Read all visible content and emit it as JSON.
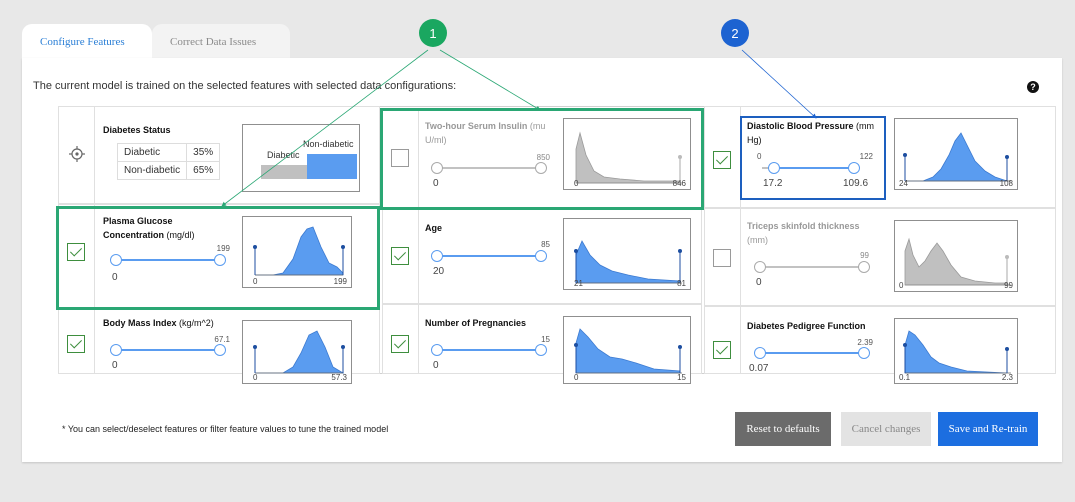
{
  "tabs": [
    {
      "label": "Configure Features",
      "active": true
    },
    {
      "label": "Correct Data Issues",
      "active": false
    }
  ],
  "intro_text": "The current model is trained on the selected features with selected data configurations:",
  "help_icon": "?",
  "target": {
    "title": "Diabetes Status",
    "icon": "crosshair-icon",
    "rows": [
      {
        "label": "Diabetic",
        "pct": "35%"
      },
      {
        "label": "Non-diabetic",
        "pct": "65%"
      }
    ],
    "bar_labels": {
      "left": "Diabetic",
      "right": "Non-diabetic"
    },
    "bar_fractions": {
      "diabetic": 0.35,
      "non_diabetic": 0.65
    }
  },
  "features": {
    "insulin": {
      "title": "Two-hour Serum Insulin",
      "unit": " (mu U/ml)",
      "checked": false,
      "slider_min": "0",
      "slider_max": "850",
      "hist_min": "0",
      "hist_max": "846"
    },
    "bp": {
      "title": "Diastolic Blood Pressure",
      "unit": " (mm Hg)",
      "checked": true,
      "range_min": "0",
      "range_max": "122",
      "slider_min": "17.2",
      "slider_max": "109.6",
      "hist_min": "24",
      "hist_max": "108"
    },
    "glucose": {
      "title": "Plasma Glucose Concentration",
      "unit": " (mg/dl)",
      "checked": true,
      "slider_min": "0",
      "slider_max": "199",
      "hist_min": "0",
      "hist_max": "199"
    },
    "age": {
      "title": "Age",
      "unit": "",
      "checked": true,
      "slider_min": "20",
      "slider_max": "85",
      "hist_min": "21",
      "hist_max": "81"
    },
    "triceps": {
      "title": "Triceps skinfold thickness",
      "unit": " (mm)",
      "checked": false,
      "slider_min": "0",
      "slider_max": "99",
      "hist_min": "0",
      "hist_max": "99"
    },
    "bmi": {
      "title": "Body Mass Index",
      "unit": " (kg/m^2)",
      "checked": true,
      "slider_min": "0",
      "slider_max": "67.1",
      "hist_min": "0",
      "hist_max": "57.3"
    },
    "pregnancies": {
      "title": "Number of Pregnancies",
      "unit": "",
      "checked": true,
      "slider_min": "0",
      "slider_max": "15",
      "hist_min": "0",
      "hist_max": "15"
    },
    "pedigree": {
      "title": "Diabetes Pedigree Function",
      "unit": "",
      "checked": true,
      "slider_min": "0.07",
      "slider_max": "2.39",
      "hist_min": "0.1",
      "hist_max": "2.3"
    }
  },
  "callouts": [
    {
      "label": "1",
      "color": "#1aa760"
    },
    {
      "label": "2",
      "color": "#1d63d1"
    }
  ],
  "footnote": "* You can select/deselect features or filter feature values to tune the trained model",
  "buttons": {
    "reset": "Reset to defaults",
    "cancel": "Cancel changes",
    "save": "Save and Re-train"
  },
  "colors": {
    "accent": "#1c6ee0",
    "hist_fill": "#5a9cf0",
    "hist_gray": "#c0c0c0",
    "green": "#2aa774",
    "blue_box": "#1d5fbf"
  }
}
